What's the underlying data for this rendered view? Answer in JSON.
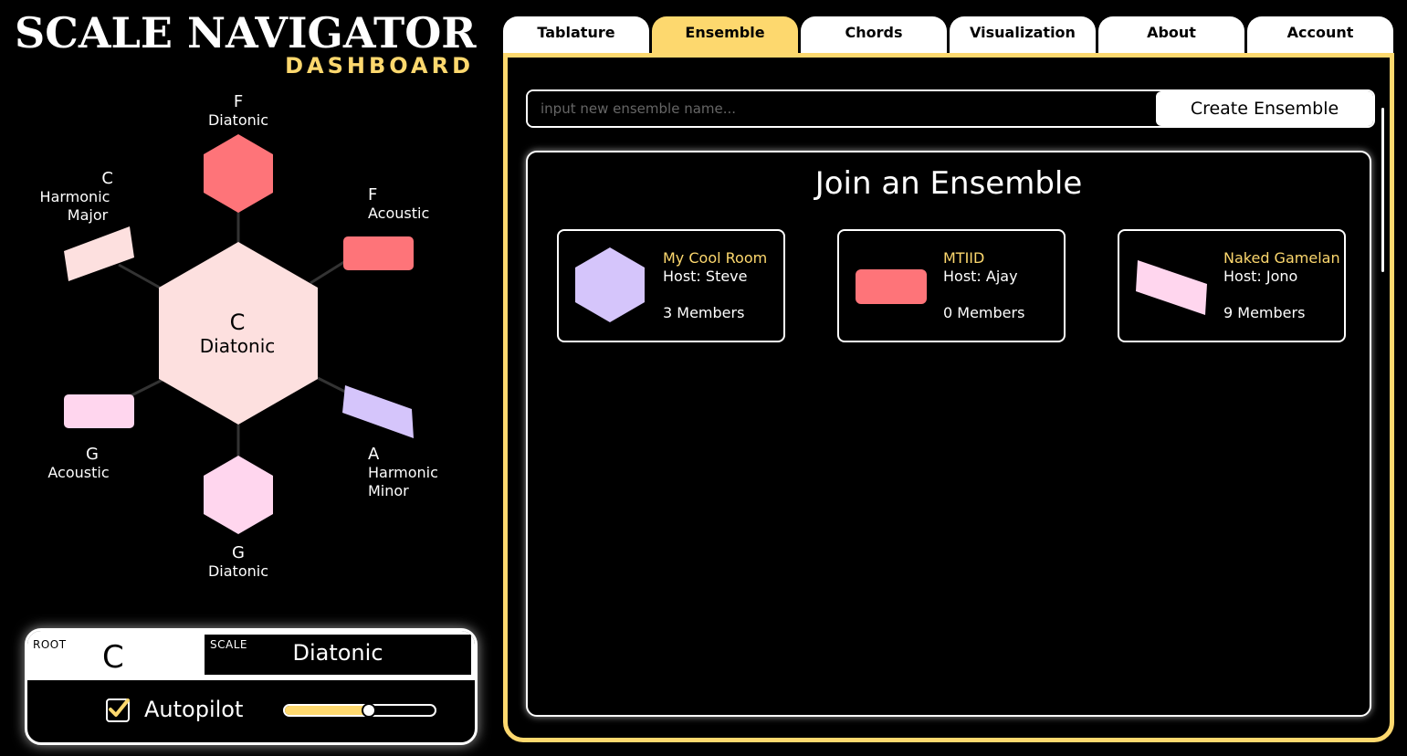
{
  "brand": {
    "title": "SCALE NAVIGATOR",
    "subtitle": "DASHBOARD"
  },
  "colors": {
    "accent": "#fdd86e",
    "salmon": "#fe7479",
    "pink": "#ffd6ee",
    "peach": "#fde0df",
    "lavender": "#d5c5fb"
  },
  "wheel": {
    "center": {
      "root": "C",
      "scale": "Diatonic"
    },
    "top": {
      "root": "F",
      "scale": "Diatonic"
    },
    "upper_right": {
      "root": "F",
      "scale": "Acoustic"
    },
    "upper_left": {
      "root": "C",
      "scale_line1": "Harmonic",
      "scale_line2": "Major"
    },
    "lower_left": {
      "root": "G",
      "scale": "Acoustic"
    },
    "lower_right": {
      "root": "A",
      "scale_line1": "Harmonic",
      "scale_line2": "Minor"
    },
    "bottom": {
      "root": "G",
      "scale": "Diatonic"
    }
  },
  "controls": {
    "root_label": "ROOT",
    "root_value": "C",
    "scale_label": "SCALE",
    "scale_value": "Diatonic",
    "autopilot_label": "Autopilot",
    "autopilot_checked": true,
    "autopilot_speed": 0.55
  },
  "tabs": [
    {
      "label": "Tablature",
      "active": false
    },
    {
      "label": "Ensemble",
      "active": true
    },
    {
      "label": "Chords",
      "active": false
    },
    {
      "label": "Visualization",
      "active": false
    },
    {
      "label": "About",
      "active": false
    },
    {
      "label": "Account",
      "active": false
    }
  ],
  "ensemble": {
    "input_placeholder": "input new ensemble name...",
    "input_value": "",
    "create_label": "Create Ensemble",
    "join_title": "Join an Ensemble",
    "rooms": [
      {
        "name": "My Cool Room",
        "host": "Host: Steve",
        "members": "3 Members",
        "shape": "hexagon",
        "color": "#d5c5fb"
      },
      {
        "name": "MTIID",
        "host": "Host: Ajay",
        "members": "0 Members",
        "shape": "rect",
        "color": "#fe7479"
      },
      {
        "name": "Naked Gamelan",
        "host": "Host: Jono",
        "members": "9 Members",
        "shape": "parallelogram",
        "color": "#ffd6ee"
      }
    ]
  }
}
